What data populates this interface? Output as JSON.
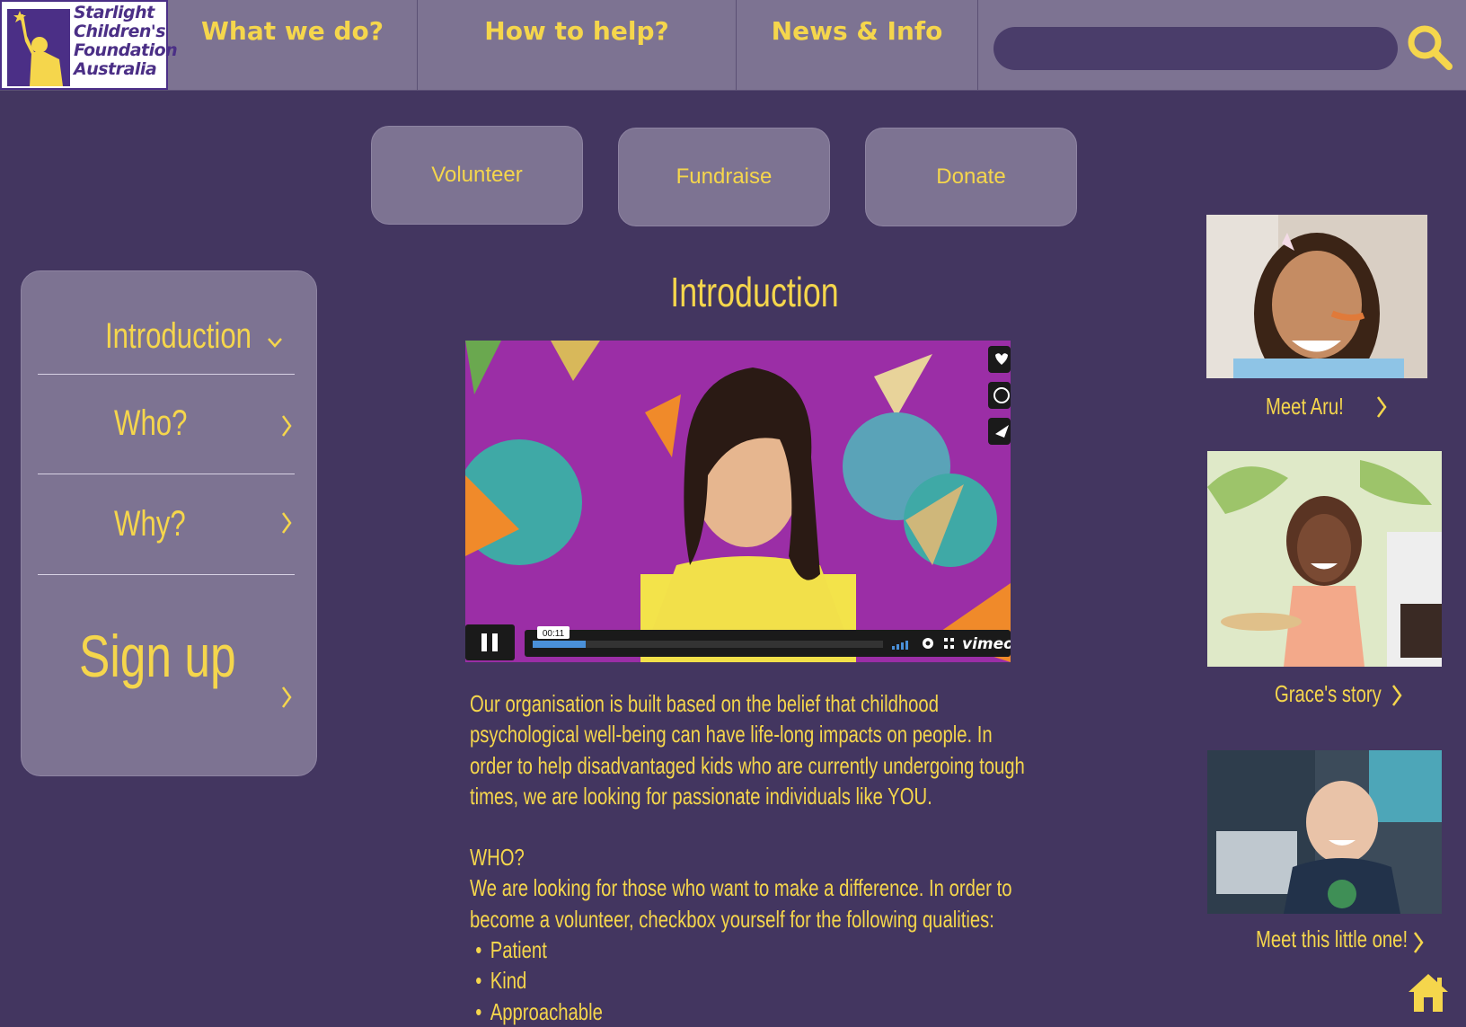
{
  "logo": {
    "lines": [
      "Starlight",
      "Children's",
      "Foundation",
      "Australia"
    ]
  },
  "nav": {
    "items": [
      {
        "label": "What we do?"
      },
      {
        "label": "How to help?"
      },
      {
        "label": "News & Info"
      }
    ],
    "search_placeholder": ""
  },
  "actions": [
    {
      "label": "Volunteer"
    },
    {
      "label": "Fundraise"
    },
    {
      "label": "Donate"
    }
  ],
  "sidebar": {
    "items": [
      {
        "label": "Introduction",
        "state": "expanded"
      },
      {
        "label": "Who?"
      },
      {
        "label": "Why?"
      }
    ],
    "signup_label": "Sign up"
  },
  "main": {
    "title": "Introduction",
    "video": {
      "time": "00:11",
      "progress": 0.15,
      "brand": "vimeo"
    },
    "paragraph": "Our organisation is built based on the belief that childhood psychological well-being can have life-long impacts on people. In order to help disadvantaged kids who are currently undergoing tough times, we are looking for passionate individuals like YOU.",
    "who_heading": "WHO?",
    "who_text": "We are looking for those who want to make a difference. In order to become a volunteer, checkbox yourself for the following qualities:",
    "qualities": [
      "Patient",
      "Kind",
      "Approachable"
    ]
  },
  "stories": [
    {
      "label": "Meet Aru!"
    },
    {
      "label": "Grace's story"
    },
    {
      "label": "Meet this little one!"
    }
  ],
  "colors": {
    "background": "#433660",
    "panel": "#7d7392",
    "accent": "#f5d64c",
    "brand_purple": "#4b2f86"
  }
}
